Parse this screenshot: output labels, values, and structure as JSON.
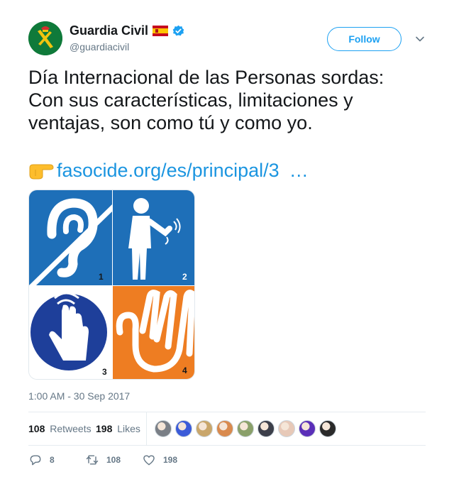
{
  "user": {
    "display_name": "Guardia Civil",
    "handle": "@guardiacivil",
    "verified": true,
    "flag_icon": "spain-flag-icon",
    "avatar_colors": {
      "bg": "#0f7a3a",
      "emblem": "#f2c40f"
    }
  },
  "follow_button": {
    "label": "Follow"
  },
  "tweet": {
    "text_lines": [
      "Día Internacional de las Personas sordas:",
      "Con sus características, limitaciones y",
      "ventajas, son como tú y como yo."
    ],
    "link_text": "fasocide.org/es/principal/3",
    "link_ellipsis": "…"
  },
  "media": {
    "panels": [
      {
        "number": "1",
        "icon": "ear-icon",
        "bg": "#1e6fb8"
      },
      {
        "number": "2",
        "icon": "person-signing-icon",
        "bg": "#1e6fb8"
      },
      {
        "number": "3",
        "icon": "hand-touch-icon",
        "bg": "#1e3f9a"
      },
      {
        "number": "4",
        "icon": "sign-hand-icon",
        "bg": "#ee7d22"
      }
    ]
  },
  "timestamp": "1:00 AM - 30 Sep 2017",
  "stats": {
    "retweets_count": "108",
    "retweets_label": "Retweets",
    "likes_count": "198",
    "likes_label": "Likes"
  },
  "liker_avatars": [
    "#7a7f86",
    "#3b5bd8",
    "#c9a66b",
    "#d98a4e",
    "#8aa06a",
    "#3c3f4a",
    "#e7c9b8",
    "#5a2fb8",
    "#2a2a2a"
  ],
  "actions": {
    "reply_count": "8",
    "retweet_count": "108",
    "like_count": "198"
  },
  "colors": {
    "accent": "#1da1f2",
    "link": "#1b95e0",
    "muted": "#657786"
  }
}
